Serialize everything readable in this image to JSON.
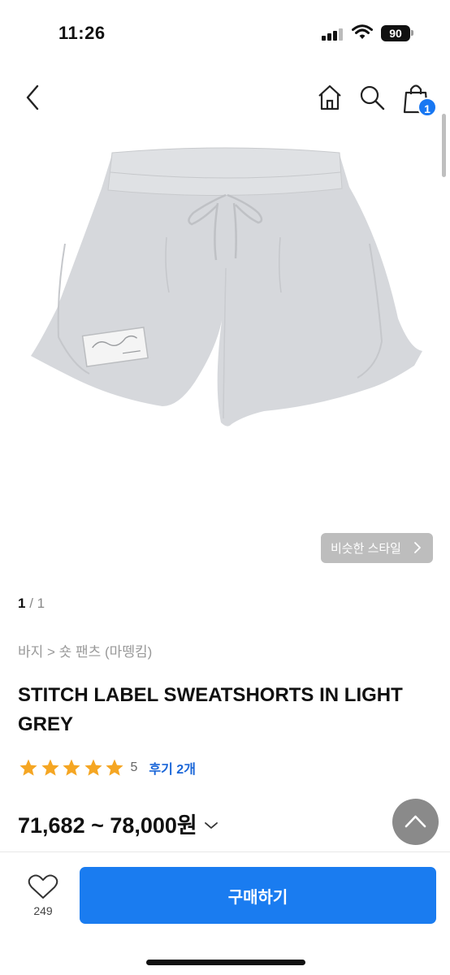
{
  "status_bar": {
    "time": "11:26",
    "battery": "90"
  },
  "header": {
    "cart_count": "1"
  },
  "gallery": {
    "current_page": "1",
    "total_pages": "/ 1",
    "similar_style_label": "비슷한 스타일"
  },
  "product": {
    "breadcrumb": "바지 > 숏 팬츠 (마뗑킴)",
    "title": "STITCH LABEL SWEATSHORTS IN LIGHT GREY",
    "rating": 5,
    "rating_label": "5",
    "review_label": "후기 2개",
    "price": "71,682 ~ 78,000원"
  },
  "bottom_bar": {
    "like_count": "249",
    "buy_label": "구매하기"
  },
  "colors": {
    "accent": "#1a7cf0",
    "star": "#f5a623",
    "review_link": "#1a66d8",
    "shorts": "#d6d8dc"
  },
  "icons": [
    "back-icon",
    "home-icon",
    "search-icon",
    "shopping-bag-icon",
    "chevron-right-icon",
    "star-icon",
    "chevron-down-icon",
    "arrow-up-icon",
    "heart-icon"
  ]
}
